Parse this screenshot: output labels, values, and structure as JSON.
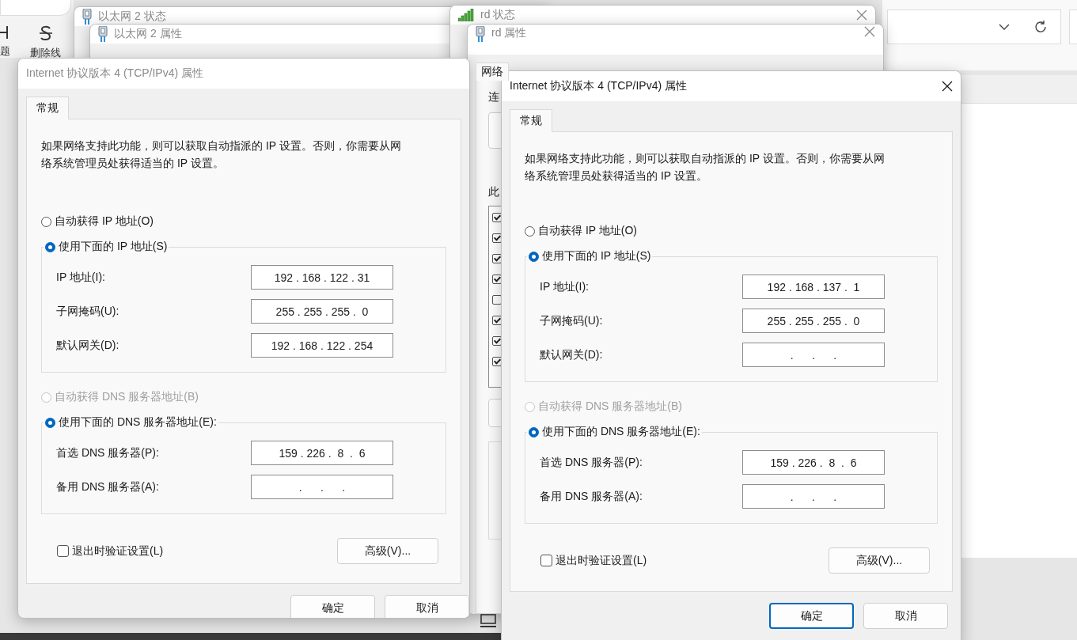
{
  "editor_toolbar": [
    {
      "kind": "heading",
      "label": "题"
    },
    {
      "kind": "strikethrough",
      "label": "删除线"
    }
  ],
  "background_windows": [
    {
      "title": "以太网 2 状态"
    },
    {
      "title": "以太网 2 属性"
    },
    {
      "title": "rd 状态"
    },
    {
      "title": "rd 属性",
      "tabs": [
        {
          "label": "网络",
          "selected": true
        }
      ],
      "labels": [
        "连",
        "此"
      ],
      "items": [
        {
          "checked": true
        },
        {
          "checked": true
        },
        {
          "checked": true
        },
        {
          "checked": true
        },
        {
          "checked": false
        },
        {
          "checked": true
        },
        {
          "checked": true
        },
        {
          "checked": true
        }
      ]
    }
  ],
  "dialogs": [
    {
      "active": false,
      "title": "Internet 协议版本 4 (TCP/IPv4) 属性",
      "tabs": [
        {
          "label": "常规",
          "selected": true
        }
      ],
      "description": "如果网络支持此功能，则可以获取自动指派的 IP 设置。否则，你需要从网络系统管理员处获得适当的 IP 设置。",
      "ip_mode": [
        {
          "label": "自动获得 IP 地址(O)",
          "selected": false,
          "disabled": false
        },
        {
          "label": "使用下面的 IP 地址(S)",
          "selected": true,
          "disabled": false
        }
      ],
      "ip_fields": [
        {
          "label": "IP 地址(I):",
          "value": "192 . 168 . 122 . 31"
        },
        {
          "label": "子网掩码(U):",
          "value": "255 . 255 . 255 .  0"
        },
        {
          "label": "默认网关(D):",
          "value": "192 . 168 . 122 . 254"
        }
      ],
      "dns_mode": [
        {
          "label": "自动获得 DNS 服务器地址(B)",
          "selected": false,
          "disabled": true
        },
        {
          "label": "使用下面的 DNS 服务器地址(E):",
          "selected": true,
          "disabled": false
        }
      ],
      "dns_fields": [
        {
          "label": "首选 DNS 服务器(P):",
          "value": "159 . 226 .  8  .  6"
        },
        {
          "label": "备用 DNS 服务器(A):",
          "value": ".      .      ."
        }
      ],
      "validate": {
        "label": "退出时验证设置(L)",
        "checked": false
      },
      "advanced_button": "高级(V)...",
      "buttons": [
        {
          "label": "确定",
          "default": false
        },
        {
          "label": "取消",
          "default": false
        }
      ]
    },
    {
      "active": true,
      "title": "Internet 协议版本 4 (TCP/IPv4) 属性",
      "tabs": [
        {
          "label": "常规",
          "selected": true
        }
      ],
      "description": "如果网络支持此功能，则可以获取自动指派的 IP 设置。否则，你需要从网络系统管理员处获得适当的 IP 设置。",
      "ip_mode": [
        {
          "label": "自动获得 IP 地址(O)",
          "selected": false,
          "disabled": false
        },
        {
          "label": "使用下面的 IP 地址(S)",
          "selected": true,
          "disabled": false
        }
      ],
      "ip_fields": [
        {
          "label": "IP 地址(I):",
          "value": "192 . 168 . 137 .  1"
        },
        {
          "label": "子网掩码(U):",
          "value": "255 . 255 . 255 .  0"
        },
        {
          "label": "默认网关(D):",
          "value": ".      .      ."
        }
      ],
      "dns_mode": [
        {
          "label": "自动获得 DNS 服务器地址(B)",
          "selected": false,
          "disabled": true
        },
        {
          "label": "使用下面的 DNS 服务器地址(E):",
          "selected": true,
          "disabled": false
        }
      ],
      "dns_fields": [
        {
          "label": "首选 DNS 服务器(P):",
          "value": "159 . 226 .  8  .  6"
        },
        {
          "label": "备用 DNS 服务器(A):",
          "value": ".      .      ."
        }
      ],
      "validate": {
        "label": "退出时验证设置(L)",
        "checked": false
      },
      "advanced_button": "高级(V)...",
      "buttons": [
        {
          "label": "确定",
          "default": true
        },
        {
          "label": "取消",
          "default": false
        }
      ]
    }
  ]
}
